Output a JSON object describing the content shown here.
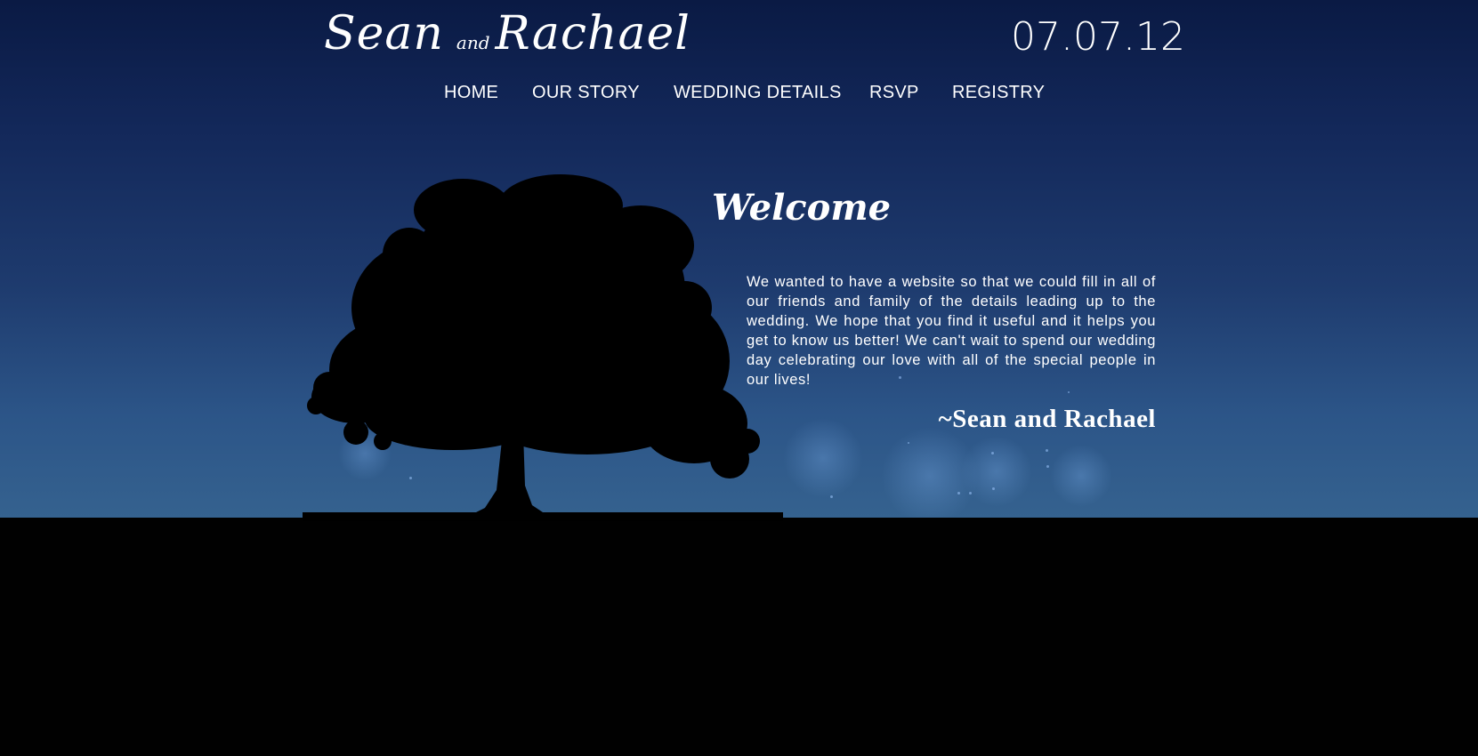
{
  "header": {
    "logo": {
      "first": "Sean",
      "connector": "and",
      "second": "Rachael"
    },
    "date": "07.07.12"
  },
  "nav": {
    "items": [
      {
        "label": "HOME"
      },
      {
        "label": "OUR STORY"
      },
      {
        "label": "WEDDING DETAILS"
      },
      {
        "label": "RSVP"
      },
      {
        "label": "REGISTRY"
      }
    ]
  },
  "main": {
    "title": "Welcome",
    "message": "We wanted to have a website so that we could fill in all of our friends and family of the details leading up to the wedding. We hope that you find it useful and it helps you get to know us better! We can't wait to spend our wedding day celebrating our love with all of the special people in our lives!",
    "signature": "~Sean and Rachael"
  },
  "theme": {
    "sky_top": "#0a1a44",
    "sky_bottom": "#35628f",
    "ground": "#010101",
    "text": "#ffffff"
  }
}
